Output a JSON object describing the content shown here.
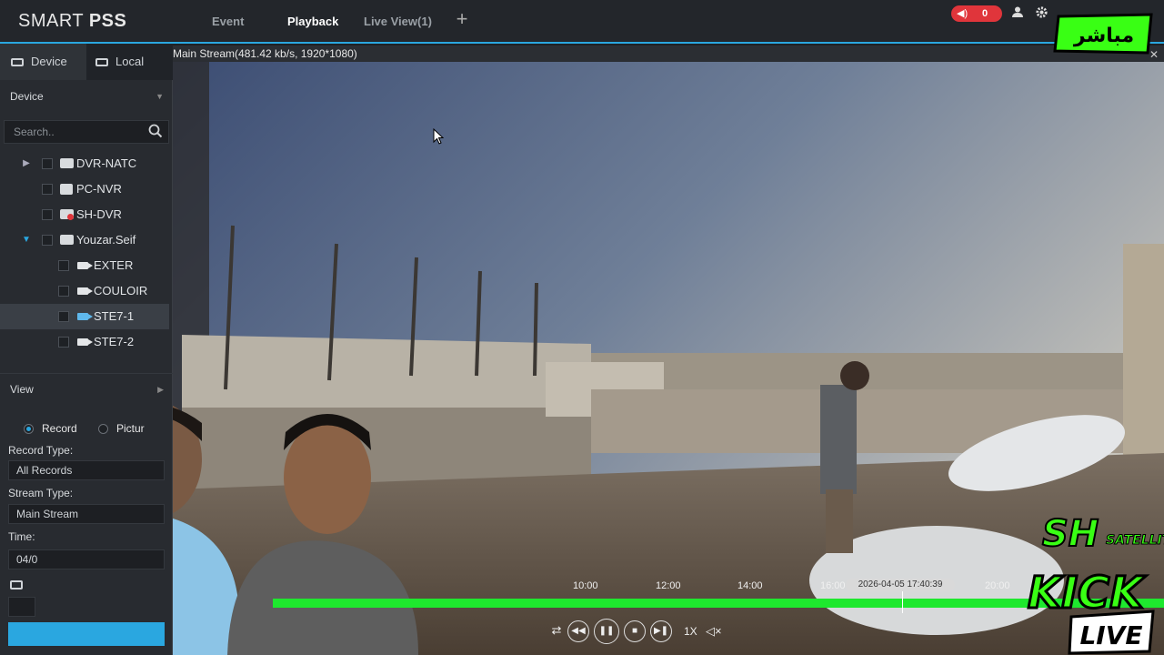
{
  "app": {
    "logo_light": "SMART ",
    "logo_bold": "PSS"
  },
  "nav": {
    "tabs": [
      {
        "label": "Event"
      },
      {
        "label": "Playback"
      },
      {
        "label": "Live View(1)"
      }
    ],
    "alarm_count": "0"
  },
  "sidebar": {
    "tabs": [
      {
        "label": "Device"
      },
      {
        "label": "Local"
      }
    ],
    "device_section": "Device",
    "search_placeholder": "Search..",
    "tree": [
      {
        "label": "DVR-NATC"
      },
      {
        "label": "PC-NVR"
      },
      {
        "label": "SH-DVR"
      },
      {
        "label": "Youzar.Seif"
      },
      {
        "label": "EXTER"
      },
      {
        "label": "COULOIR"
      },
      {
        "label": "STE7-1"
      },
      {
        "label": "STE7-2"
      }
    ],
    "view_section": "View",
    "radio_record": "Record",
    "radio_picture": "Pictur",
    "record_type_label": "Record Type:",
    "record_type_value": "All Records",
    "stream_type_label": "Stream Type:",
    "stream_type_value": "Main Stream",
    "time_label": "Time:",
    "time_value": "04/0"
  },
  "player": {
    "stream_info": "Main Stream(481.42 kb/s, 1920*1080)",
    "timeline_ticks": [
      "10:00",
      "12:00",
      "14:00",
      "16:00",
      "20:00"
    ],
    "cursor_time": "2026-04-05 17:40:39",
    "speed": "1X"
  },
  "overlay": {
    "live_badge_text": "مباشر",
    "channel_sh": "SH",
    "channel_satellite": "SATELLITE",
    "channel_kick": "KICK",
    "channel_live": "LIVE"
  },
  "colors": {
    "accent": "#2aa7e0",
    "timeline_green": "#1ee82e",
    "alarm_red": "#e0353b",
    "brand_green": "#39ff14"
  }
}
